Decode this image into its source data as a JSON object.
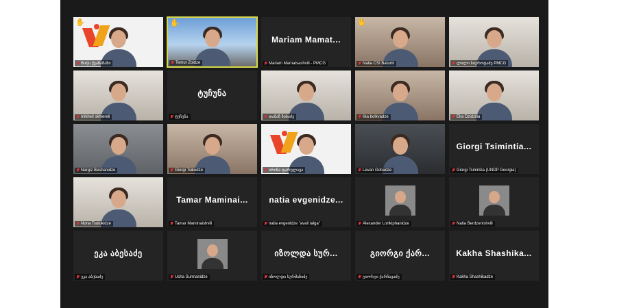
{
  "participants": [
    {
      "label": "Burju ქვანამანი",
      "bigname": "",
      "style": "logo",
      "hand": true,
      "active": false
    },
    {
      "label": "Temur Zoidze",
      "bigname": "",
      "style": "sky",
      "hand": true,
      "active": true
    },
    {
      "label": "Mariam Mamatsashvili - PMCG",
      "bigname": "Mariam  Mamat...",
      "style": "none",
      "hand": false,
      "active": false
    },
    {
      "label": "Natia CSI Batumi",
      "bigname": "",
      "style": "warm",
      "hand": true,
      "active": false
    },
    {
      "label": "ლილი სიეროტაძე PMCG",
      "bigname": "",
      "style": "light",
      "hand": false,
      "active": false
    },
    {
      "label": "mikheil skhiereli",
      "bigname": "",
      "style": "light",
      "hand": false,
      "active": false
    },
    {
      "label": "ტუჩუნა",
      "bigname": "ტუჩუნა",
      "style": "none",
      "hand": false,
      "active": false
    },
    {
      "label": "თამაზ ზიბაძე",
      "bigname": "",
      "style": "light",
      "hand": false,
      "active": false
    },
    {
      "label": "lika bolkvadze",
      "bigname": "",
      "style": "warm",
      "hand": false,
      "active": false
    },
    {
      "label": "Eka Dzidzilia",
      "bigname": "",
      "style": "light",
      "hand": false,
      "active": false
    },
    {
      "label": "Nargiz Beshanidze",
      "bigname": "",
      "style": "video",
      "hand": false,
      "active": false
    },
    {
      "label": "Giorgi Tsikodze",
      "bigname": "",
      "style": "warm",
      "hand": false,
      "active": false
    },
    {
      "label": "ირინა ფარულავა",
      "bigname": "",
      "style": "logo",
      "hand": false,
      "active": false
    },
    {
      "label": "Levan Gobadze",
      "bigname": "",
      "style": "dark",
      "hand": false,
      "active": false
    },
    {
      "label": "Giorgi Tsimintia (UNDP Georgia)",
      "bigname": "Giorgi  Tsimintia...",
      "style": "none",
      "hand": false,
      "active": false
    },
    {
      "label": "Nona Tsulukidze",
      "bigname": "",
      "style": "light",
      "hand": false,
      "active": false
    },
    {
      "label": "Tamar Maminaishvili",
      "bigname": "Tamar  Maminai...",
      "style": "none",
      "hand": false,
      "active": false
    },
    {
      "label": "natia evgenidze \"avali talga\"",
      "bigname": "natia  evgenidze...",
      "style": "none",
      "hand": false,
      "active": false
    },
    {
      "label": "Alexander Lortkiphanidze",
      "bigname": "",
      "style": "thumb",
      "hand": false,
      "active": false
    },
    {
      "label": "Natia Berdzenishvili",
      "bigname": "",
      "style": "thumb",
      "hand": false,
      "active": false
    },
    {
      "label": "ეკა აბესაძე",
      "bigname": "ეკა აბესაძე",
      "style": "none",
      "hand": false,
      "active": false
    },
    {
      "label": "Ucha Surmanidze",
      "bigname": "",
      "style": "thumb",
      "hand": false,
      "active": false
    },
    {
      "label": "იზოლდა სურმანიძე",
      "bigname": "იზოლდა  სურ...",
      "style": "none",
      "hand": false,
      "active": false
    },
    {
      "label": "გიორგი ქარჩავაძე",
      "bigname": "გიორგი  ქარ...",
      "style": "none",
      "hand": false,
      "active": false
    },
    {
      "label": "Kakha Shashikadze",
      "bigname": "Kakha  Shashika...",
      "style": "none",
      "hand": false,
      "active": false
    }
  ]
}
